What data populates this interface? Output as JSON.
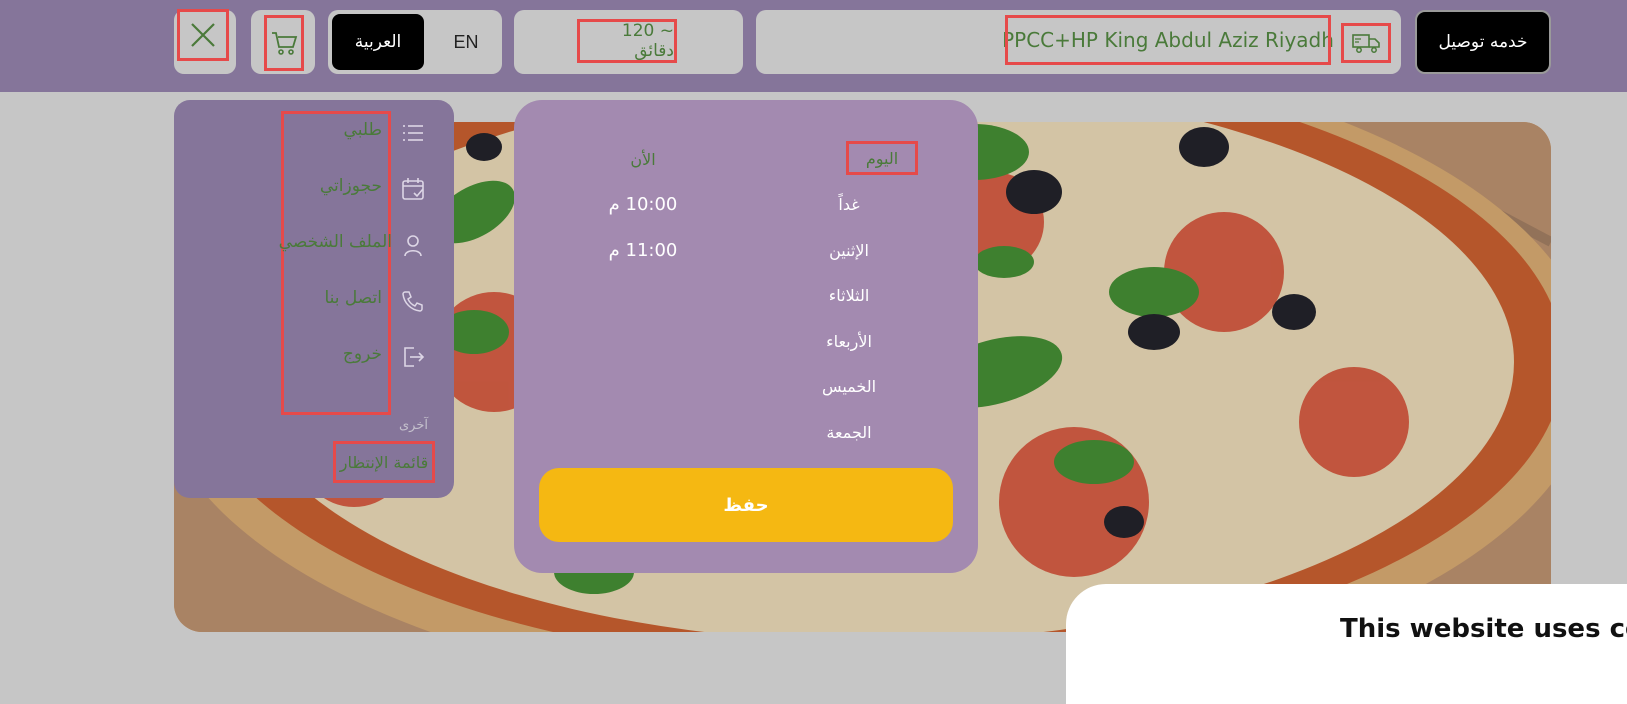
{
  "header": {
    "close_icon": "close-icon",
    "cart_icon": "cart-icon",
    "lang_arabic": "العربية",
    "lang_english": "EN",
    "delivery_time": "~ 120 دقائق",
    "address": "PPCC+HP King Abdul Aziz Riyadh",
    "truck_icon": "delivery-truck-icon",
    "service_button": "خدمه توصيل"
  },
  "menu": {
    "items": [
      {
        "label": "طلبي",
        "icon": "list-icon"
      },
      {
        "label": "حجوزاتي",
        "icon": "calendar-check-icon"
      },
      {
        "label": "الملف الشخصي",
        "icon": "user-icon"
      },
      {
        "label": "اتصل بنا",
        "icon": "phone-icon"
      },
      {
        "label": "خروج",
        "icon": "logout-icon"
      }
    ],
    "other_label": "آخرى",
    "waitlist": "قائمة الإنتظار"
  },
  "schedule": {
    "days": [
      "اليوم",
      "غداً",
      "الإثنين",
      "الثلاثاء",
      "الأربعاء",
      "الخميس",
      "الجمعة"
    ],
    "selected_day": "اليوم",
    "times": [
      "الأن",
      "10:00 م",
      "11:00 م"
    ],
    "save_button": "حفظ"
  },
  "cookie_banner": {
    "title": "This website uses co"
  },
  "colors": {
    "header_bg": "#85759a",
    "schedule_bg": "#a38ab0",
    "accent_yellow": "#f5b812",
    "text_green": "#4a7a3a"
  }
}
